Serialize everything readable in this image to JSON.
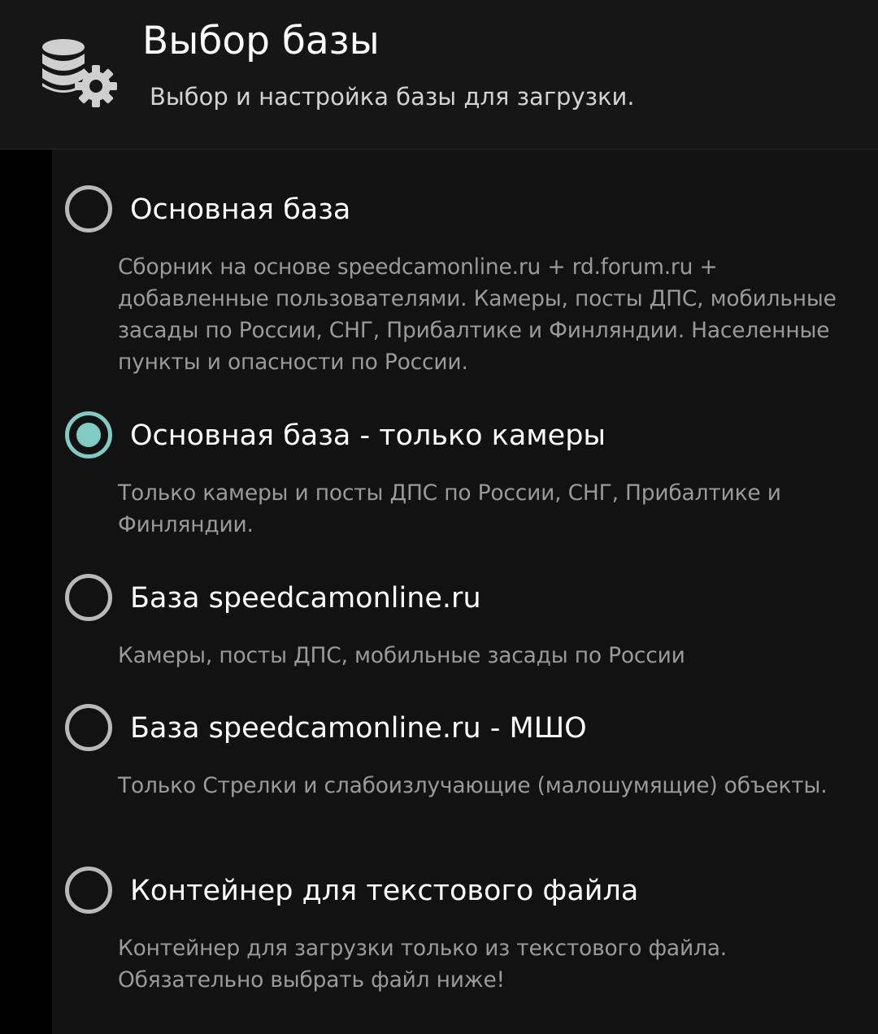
{
  "header": {
    "icon": "database-gear-icon",
    "title": "Выбор базы",
    "subtitle": "Выбор и настройка базы для загрузки."
  },
  "colors": {
    "accent": "#80cbc4",
    "background": "#121212",
    "header_background": "#161616",
    "title_text": "#ffffff",
    "description_text": "#9a9a9a",
    "radio_unchecked": "#b9b9b9"
  },
  "options": [
    {
      "label": "Основная база",
      "description": "Сборник на основе speedcamonline.ru + rd.forum.ru + добавленные пользователями. Камеры, посты ДПС, мобильные засады по России, СНГ, Прибалтике и Финляндии. Населенные пункты и опасности по России.",
      "selected": false
    },
    {
      "label": "Основная база - только камеры",
      "description": "Только камеры и посты ДПС по России, СНГ, Прибалтике и Финляндии.",
      "selected": true
    },
    {
      "label": "База speedcamonline.ru",
      "description": "Камеры, посты ДПС, мобильные засады по России",
      "selected": false
    },
    {
      "label": "База speedcamonline.ru - МШО",
      "description": "Только Стрелки и слабоизлучающие (малошумящие) объекты.",
      "selected": false
    },
    {
      "label": "Контейнер для текстового файла",
      "description": "Контейнер для загрузки только из текстового файла. Обязательно выбрать файл ниже!",
      "selected": false
    }
  ]
}
